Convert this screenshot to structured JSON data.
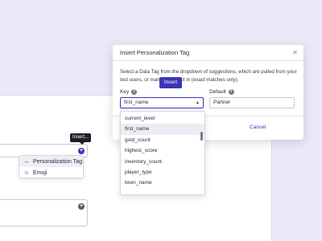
{
  "colors": {
    "background": "#ebe9f8",
    "accent": "#3b35b4",
    "tooltip_bg": "#1e1f2a"
  },
  "editor": {
    "tooltip": "Insert...",
    "plus_icon": "+",
    "insert_menu": [
      {
        "icon": "arrows-icon",
        "glyph": "↔",
        "label": "Personalization Tag"
      },
      {
        "icon": "emoji-icon",
        "glyph": "☺",
        "label": "Emoji"
      }
    ]
  },
  "modal": {
    "title": "Insert Personalization Tag",
    "close_glyph": "✕",
    "description": "Select a Data Tag from the dropdown of suggestions, which are pulled from your test users, or manually type it in (exact matches only).",
    "key_label": "Key",
    "default_label": "Default",
    "help_glyph": "?",
    "key_value": "first_name",
    "default_value": "Partner",
    "cancel_label": "Cancel",
    "insert_label": "Insert"
  },
  "dropdown": {
    "items": [
      "current_level",
      "first_name",
      "gold_count",
      "highest_score",
      "inventory_count",
      "player_type",
      "town_name"
    ],
    "selected": "first_name"
  }
}
